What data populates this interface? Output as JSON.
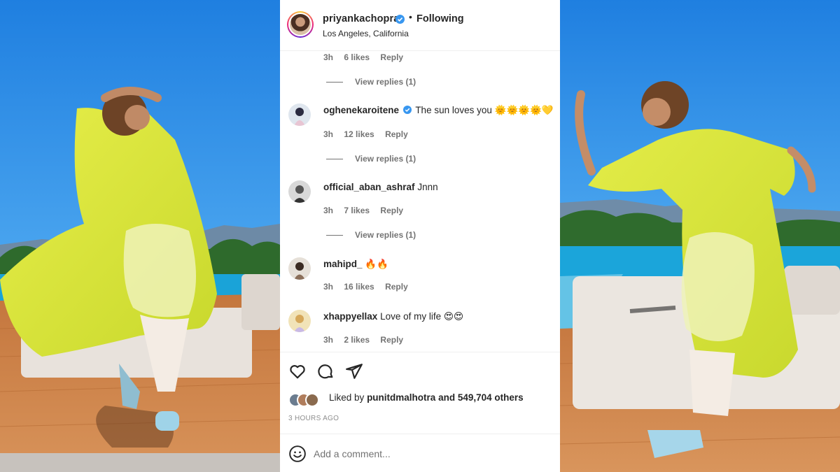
{
  "post": {
    "username": "priyankachopra",
    "follow_status": "Following",
    "separator": "•",
    "location": "Los Angeles, California"
  },
  "top_comment_meta": {
    "time": "3h",
    "likes": "6 likes",
    "reply": "Reply",
    "view_replies": "View replies (1)"
  },
  "comments": [
    {
      "username": "oghenekaroitene",
      "verified": true,
      "text": "The sun loves you",
      "emoji": "🌞🌞🌞🌞💛",
      "time": "3h",
      "likes": "12 likes",
      "reply": "Reply",
      "view_replies": "View replies (1)"
    },
    {
      "username": "official_aban_ashraf",
      "verified": false,
      "text": "Jnnn",
      "emoji": "",
      "time": "3h",
      "likes": "7 likes",
      "reply": "Reply",
      "view_replies": "View replies (1)"
    },
    {
      "username": "mahipd_",
      "verified": false,
      "text": "",
      "emoji": "🔥🔥",
      "time": "3h",
      "likes": "16 likes",
      "reply": "Reply",
      "view_replies": ""
    },
    {
      "username": "xhappyellax",
      "verified": false,
      "text": "Love of my life",
      "emoji": "😍😍",
      "time": "3h",
      "likes": "2 likes",
      "reply": "Reply",
      "view_replies": ""
    }
  ],
  "likes_summary": {
    "prefix": "Liked by",
    "user": "punitdmalhotra",
    "suffix": "and 549,704 others"
  },
  "post_timestamp": "3 HOURS AGO",
  "comment_box": {
    "placeholder": "Add a comment..."
  },
  "icons": {
    "like": "heart-icon",
    "comment": "comment-bubble-icon",
    "share": "paper-plane-icon",
    "emoji": "smiley-icon",
    "verified": "verified-badge-icon"
  },
  "colors": {
    "verified_blue": "#3897f0",
    "secondary_text": "#737373",
    "dress_yellow": "#d8e63a",
    "sky_blue": "#2f8fe0"
  }
}
